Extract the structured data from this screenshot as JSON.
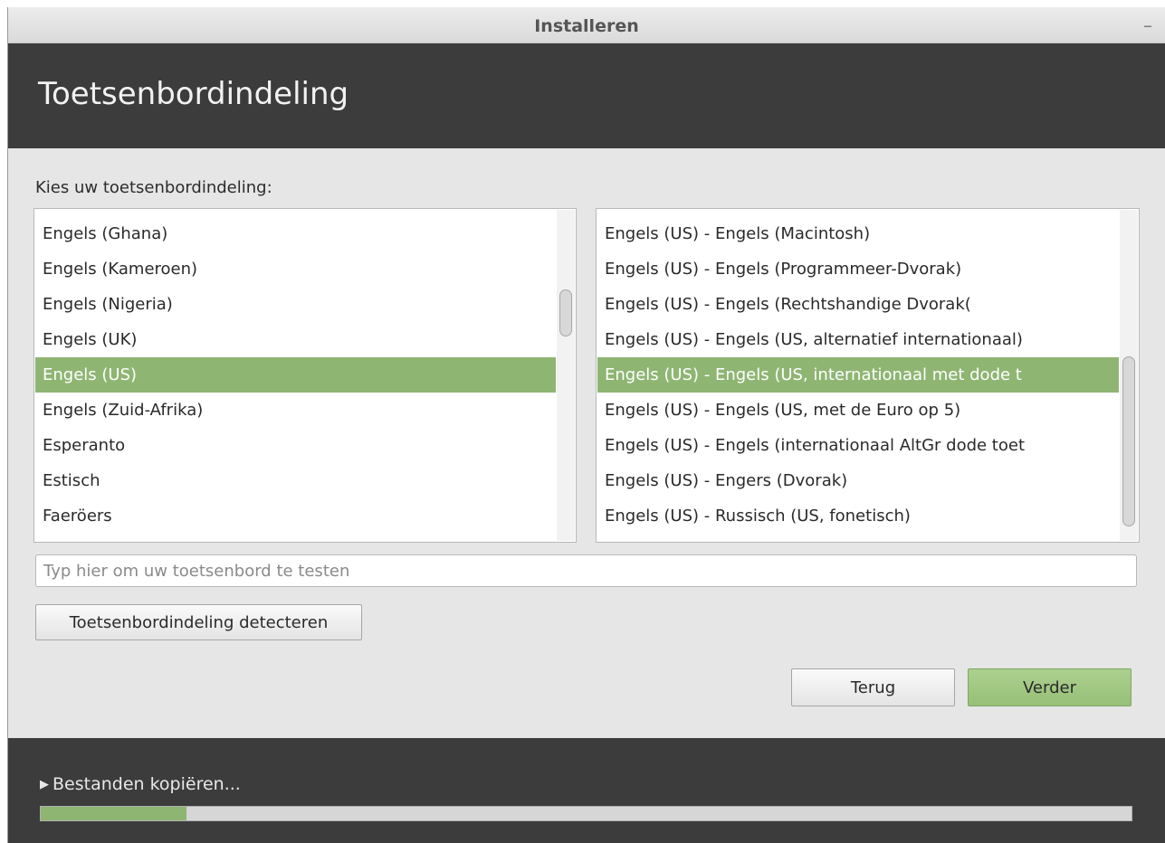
{
  "window": {
    "title": "Installeren",
    "minimize_symbol": "–"
  },
  "header": {
    "title": "Toetsenbordindeling"
  },
  "main": {
    "prompt": "Kies uw toetsenbordindeling:",
    "layouts": [
      {
        "label": "Engels (Ghana)",
        "selected": false
      },
      {
        "label": "Engels (Kameroen)",
        "selected": false
      },
      {
        "label": "Engels (Nigeria)",
        "selected": false
      },
      {
        "label": "Engels (UK)",
        "selected": false
      },
      {
        "label": "Engels (US)",
        "selected": true
      },
      {
        "label": "Engels (Zuid-Afrika)",
        "selected": false
      },
      {
        "label": "Esperanto",
        "selected": false
      },
      {
        "label": "Estisch",
        "selected": false
      },
      {
        "label": "Faeröers",
        "selected": false
      }
    ],
    "variants": [
      {
        "label": "Engels (US) - Engels (Macintosh)",
        "selected": false
      },
      {
        "label": "Engels (US) - Engels (Programmeer-Dvorak)",
        "selected": false
      },
      {
        "label": "Engels (US) - Engels (Rechtshandige Dvorak(",
        "selected": false
      },
      {
        "label": "Engels (US) - Engels (US, alternatief internationaal)",
        "selected": false
      },
      {
        "label": "Engels (US) - Engels (US, internationaal met dode t",
        "selected": true
      },
      {
        "label": "Engels (US) - Engels (US, met de Euro op 5)",
        "selected": false
      },
      {
        "label": "Engels (US) - Engels (internationaal AltGr dode toet",
        "selected": false
      },
      {
        "label": "Engels (US) - Engers (Dvorak)",
        "selected": false
      },
      {
        "label": "Engels (US) - Russisch (US, fonetisch)",
        "selected": false
      }
    ],
    "test_input": {
      "value": "",
      "placeholder": "Typ hier om uw toetsenbord te testen"
    },
    "detect_button": "Toetsenbordindeling detecteren",
    "back_button": "Terug",
    "next_button": "Verder"
  },
  "footer": {
    "triangle_symbol": "▶",
    "progress_label": "Bestanden kopiëren...",
    "progress_fraction": 0.134
  },
  "colors": {
    "accent_green": "#8fb573",
    "header_dark": "#3c3c3c"
  }
}
